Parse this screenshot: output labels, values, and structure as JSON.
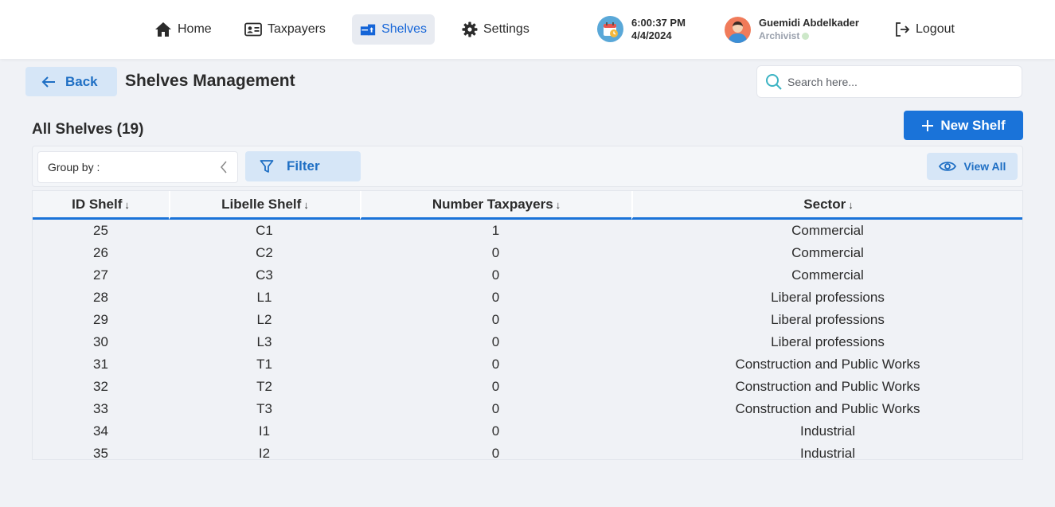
{
  "nav": {
    "home": "Home",
    "taxpayers": "Taxpayers",
    "shelves": "Shelves",
    "settings": "Settings",
    "logout": "Logout"
  },
  "clock": {
    "time": "6:00:37 PM",
    "date": "4/4/2024"
  },
  "user": {
    "name": "Guemidi Abdelkader",
    "role": "Archivist"
  },
  "page": {
    "back_label": "Back",
    "title": "Shelves Management",
    "search_placeholder": "Search here...",
    "section_title": "All Shelves (19)",
    "new_shelf_label": "New Shelf"
  },
  "toolbar": {
    "group_by_label": "Group by :",
    "filter_label": "Filter",
    "view_all_label": "View All"
  },
  "table": {
    "columns": [
      "ID Shelf",
      "Libelle Shelf",
      "Number Taxpayers",
      "Sector"
    ],
    "rows": [
      [
        "25",
        "C1",
        "1",
        "Commercial"
      ],
      [
        "26",
        "C2",
        "0",
        "Commercial"
      ],
      [
        "27",
        "C3",
        "0",
        "Commercial"
      ],
      [
        "28",
        "L1",
        "0",
        "Liberal professions"
      ],
      [
        "29",
        "L2",
        "0",
        "Liberal professions"
      ],
      [
        "30",
        "L3",
        "0",
        "Liberal professions"
      ],
      [
        "31",
        "T1",
        "0",
        "Construction and Public Works"
      ],
      [
        "32",
        "T2",
        "0",
        "Construction and Public Works"
      ],
      [
        "33",
        "T3",
        "0",
        "Construction and Public Works"
      ],
      [
        "34",
        "I1",
        "0",
        "Industrial"
      ],
      [
        "35",
        "I2",
        "0",
        "Industrial"
      ]
    ]
  },
  "icons": {
    "home": "home-icon",
    "taxpayers": "id-card-icon",
    "shelves": "shelves-icon",
    "settings": "gear-icon",
    "calendar": "calendar-clock-icon",
    "logout": "logout-icon",
    "back": "arrow-left-icon",
    "search": "search-icon",
    "plus": "plus-icon",
    "chevron": "chevron-left-icon",
    "filter": "filter-icon",
    "eye": "eye-icon",
    "sort": "arrow-down-icon"
  },
  "colors": {
    "accent": "#1a73d9",
    "accent_light": "#d6e6f7",
    "background": "#f0f2f6",
    "status_online": "#cde8c9"
  }
}
